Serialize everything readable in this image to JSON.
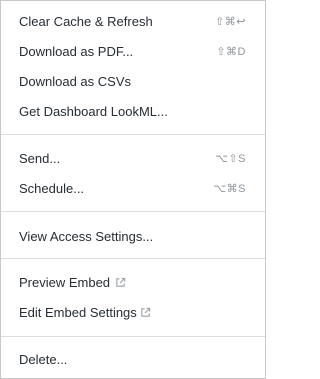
{
  "menu": {
    "items": [
      {
        "label": "Clear Cache & Refresh",
        "shortcut": "⇧⌘↩"
      },
      {
        "label": "Download as PDF...",
        "shortcut": "⇧⌘D"
      },
      {
        "label": "Download as CSVs",
        "shortcut": ""
      },
      {
        "label": "Get Dashboard LookML...",
        "shortcut": ""
      },
      {
        "label": "Send...",
        "shortcut": "⌥⇧S"
      },
      {
        "label": "Schedule...",
        "shortcut": "⌥⌘S"
      },
      {
        "label": "View Access Settings...",
        "shortcut": ""
      },
      {
        "label": "Preview Embed",
        "icon": "external-link-icon"
      },
      {
        "label": "Edit Embed Settings",
        "icon": "external-link-icon"
      },
      {
        "label": "Delete...",
        "shortcut": ""
      }
    ]
  }
}
